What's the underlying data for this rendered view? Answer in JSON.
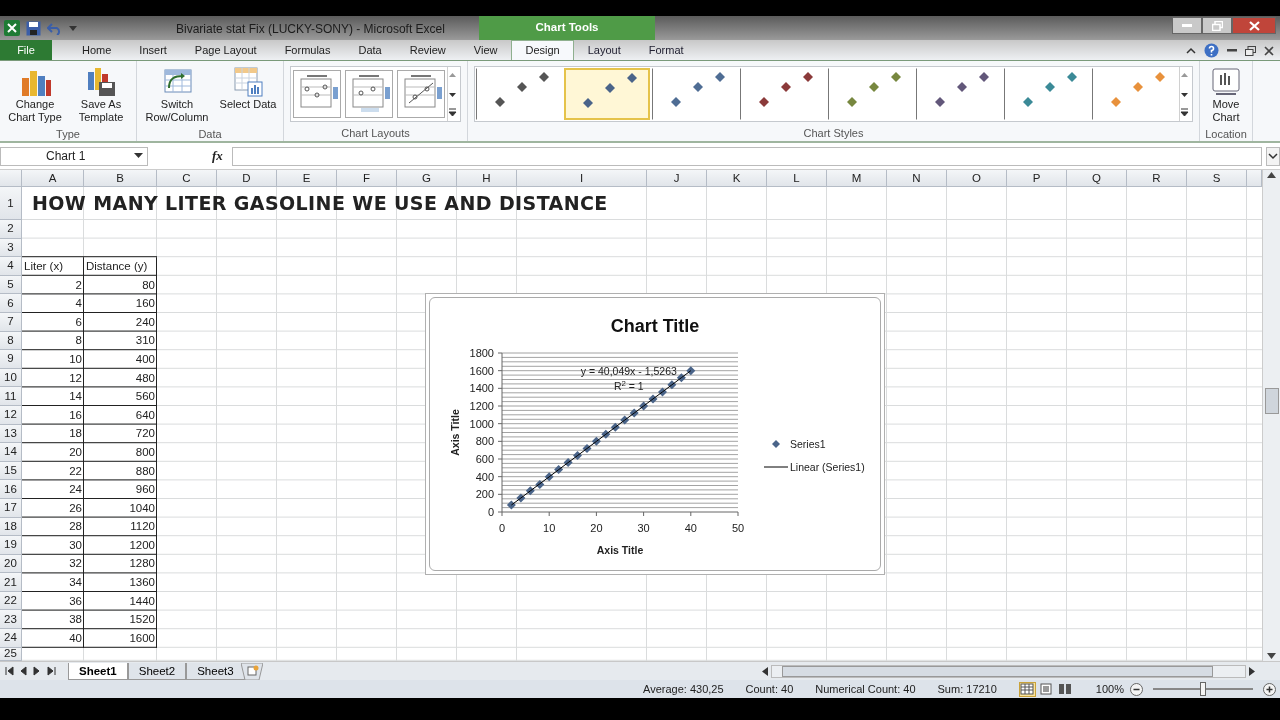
{
  "window": {
    "title": "Bivariate stat Fix (LUCKY-SONY)  -  Microsoft Excel",
    "context_tab": "Chart Tools"
  },
  "tabs": [
    {
      "label": "File",
      "kind": "file",
      "selected": false
    },
    {
      "label": "Home",
      "kind": "tab",
      "selected": false
    },
    {
      "label": "Insert",
      "kind": "tab",
      "selected": false
    },
    {
      "label": "Page Layout",
      "kind": "tab",
      "selected": false
    },
    {
      "label": "Formulas",
      "kind": "tab",
      "selected": false
    },
    {
      "label": "Data",
      "kind": "tab",
      "selected": false
    },
    {
      "label": "Review",
      "kind": "tab",
      "selected": false
    },
    {
      "label": "View",
      "kind": "tab",
      "selected": false
    },
    {
      "label": "Design",
      "kind": "context",
      "selected": true
    },
    {
      "label": "Layout",
      "kind": "context",
      "selected": false
    },
    {
      "label": "Format",
      "kind": "context",
      "selected": false
    }
  ],
  "ribbon": {
    "groups": [
      {
        "label": "Type",
        "kind": "buttons",
        "buttons": [
          {
            "label": "Change Chart Type",
            "kind": "chart"
          },
          {
            "label": "Save As Template",
            "kind": "template"
          }
        ]
      },
      {
        "label": "Data",
        "kind": "buttons",
        "buttons": [
          {
            "label": "Switch Row/Column",
            "kind": "switch"
          },
          {
            "label": "Select Data",
            "kind": "table"
          }
        ]
      },
      {
        "label": "Chart Layouts",
        "kind": "layouts",
        "items": [
          {
            "selected": false
          },
          {
            "selected": false
          },
          {
            "selected": false
          }
        ]
      },
      {
        "label": "Chart Styles",
        "kind": "styles",
        "items": [
          {
            "color": "#555555",
            "selected": false
          },
          {
            "color": "#4a6489",
            "selected": true
          },
          {
            "color": "#4f6d94",
            "selected": false
          },
          {
            "color": "#8b3a3a",
            "selected": false
          },
          {
            "color": "#77873f",
            "selected": false
          },
          {
            "color": "#62577a",
            "selected": false
          },
          {
            "color": "#3b8a97",
            "selected": false
          },
          {
            "color": "#e8913c",
            "selected": false
          }
        ]
      },
      {
        "label": "Location",
        "kind": "buttons",
        "buttons": [
          {
            "label": "Move Chart",
            "kind": "move"
          }
        ]
      }
    ]
  },
  "formula_bar": {
    "name_box": "Chart 1",
    "fx": "fx"
  },
  "sheet": {
    "columns": [
      "A",
      "B",
      "C",
      "D",
      "E",
      "F",
      "G",
      "H",
      "I",
      "J",
      "K",
      "L",
      "M",
      "N",
      "O",
      "P",
      "Q",
      "R",
      "S"
    ],
    "rows": [
      {
        "header": "1",
        "kind": "title",
        "cells": {
          "A": "HOW MANY LITER GASOLINE WE USE AND DISTANCE"
        }
      },
      {
        "header": "2"
      },
      {
        "header": "3"
      },
      {
        "header": "4",
        "kind": "header",
        "cells": {
          "A": "Liter (x)",
          "B": "Distance (y)"
        }
      },
      {
        "header": "5",
        "kind": "data",
        "cells": {
          "A": "2",
          "B": "80"
        }
      },
      {
        "header": "6",
        "kind": "data",
        "cells": {
          "A": "4",
          "B": "160"
        }
      },
      {
        "header": "7",
        "kind": "data",
        "cells": {
          "A": "6",
          "B": "240"
        }
      },
      {
        "header": "8",
        "kind": "data",
        "cells": {
          "A": "8",
          "B": "310"
        }
      },
      {
        "header": "9",
        "kind": "data",
        "cells": {
          "A": "10",
          "B": "400"
        }
      },
      {
        "header": "10",
        "kind": "data",
        "cells": {
          "A": "12",
          "B": "480"
        }
      },
      {
        "header": "11",
        "kind": "data",
        "cells": {
          "A": "14",
          "B": "560"
        }
      },
      {
        "header": "12",
        "kind": "data",
        "cells": {
          "A": "16",
          "B": "640"
        }
      },
      {
        "header": "13",
        "kind": "data",
        "cells": {
          "A": "18",
          "B": "720"
        }
      },
      {
        "header": "14",
        "kind": "data",
        "cells": {
          "A": "20",
          "B": "800"
        }
      },
      {
        "header": "15",
        "kind": "data",
        "cells": {
          "A": "22",
          "B": "880"
        }
      },
      {
        "header": "16",
        "kind": "data",
        "cells": {
          "A": "24",
          "B": "960"
        }
      },
      {
        "header": "17",
        "kind": "data",
        "cells": {
          "A": "26",
          "B": "1040"
        }
      },
      {
        "header": "18",
        "kind": "data",
        "cells": {
          "A": "28",
          "B": "1120"
        }
      },
      {
        "header": "19",
        "kind": "data",
        "cells": {
          "A": "30",
          "B": "1200"
        }
      },
      {
        "header": "20",
        "kind": "data",
        "cells": {
          "A": "32",
          "B": "1280"
        }
      },
      {
        "header": "21",
        "kind": "data",
        "cells": {
          "A": "34",
          "B": "1360"
        }
      },
      {
        "header": "22",
        "kind": "data",
        "cells": {
          "A": "36",
          "B": "1440"
        }
      },
      {
        "header": "23",
        "kind": "data",
        "cells": {
          "A": "38",
          "B": "1520"
        }
      },
      {
        "header": "24",
        "kind": "data",
        "cells": {
          "A": "40",
          "B": "1600"
        }
      },
      {
        "header": "25"
      }
    ]
  },
  "chart": {
    "chart_data": {
      "type": "scatter",
      "title": "Chart Title",
      "xlabel": "Axis Title",
      "ylabel": "Axis Title",
      "x": [
        2,
        4,
        6,
        8,
        10,
        12,
        14,
        16,
        18,
        20,
        22,
        24,
        26,
        28,
        30,
        32,
        34,
        36,
        38,
        40
      ],
      "series": [
        {
          "name": "Series1",
          "type": "scatter",
          "color": "#4a6489",
          "values": [
            80,
            160,
            240,
            310,
            400,
            480,
            560,
            640,
            720,
            800,
            880,
            960,
            1040,
            1120,
            1200,
            1280,
            1360,
            1440,
            1520,
            1600
          ]
        },
        {
          "name": "Linear (Series1)",
          "type": "line",
          "color": "#000000",
          "values": [
            79,
            159,
            239,
            319,
            399,
            479,
            559,
            639,
            719,
            799,
            880,
            960,
            1040,
            1120,
            1200,
            1280,
            1360,
            1440,
            1520,
            1600
          ]
        }
      ],
      "grid": true,
      "legend": "right",
      "xlim": [
        0,
        50
      ],
      "ylim": [
        0,
        1800
      ],
      "xticks": [
        {
          "value": 0,
          "label": "0"
        },
        {
          "value": 10,
          "label": "10"
        },
        {
          "value": 20,
          "label": "20"
        },
        {
          "value": 30,
          "label": "30"
        },
        {
          "value": 40,
          "label": "40"
        },
        {
          "value": 50,
          "label": "50"
        }
      ],
      "yticks": [
        {
          "value": 0,
          "label": "0"
        },
        {
          "value": 200,
          "label": "200"
        },
        {
          "value": 400,
          "label": "400"
        },
        {
          "value": 600,
          "label": "600"
        },
        {
          "value": 800,
          "label": "800"
        },
        {
          "value": 1000,
          "label": "1000"
        },
        {
          "value": 1200,
          "label": "1200"
        },
        {
          "value": 1400,
          "label": "1400"
        },
        {
          "value": 1600,
          "label": "1600"
        },
        {
          "value": 1800,
          "label": "1800"
        }
      ],
      "annotations": [
        "y = 40,049x - 1,5263",
        "R$^{2}$ = 1"
      ]
    }
  },
  "sheet_tabs": [
    {
      "label": "Sheet1",
      "selected": true
    },
    {
      "label": "Sheet2",
      "selected": false
    },
    {
      "label": "Sheet3",
      "selected": false
    }
  ],
  "status_bar": {
    "items": [
      "Average: 430,25",
      "Count: 40",
      "Numerical Count: 40",
      "Sum: 17210"
    ],
    "views": [
      {
        "kind": "normal",
        "selected": true
      },
      {
        "kind": "layout",
        "selected": false
      },
      {
        "kind": "pagebreak",
        "selected": false
      }
    ],
    "zoom": "100%",
    "zoom_level": {
      "level": 0.5
    }
  }
}
